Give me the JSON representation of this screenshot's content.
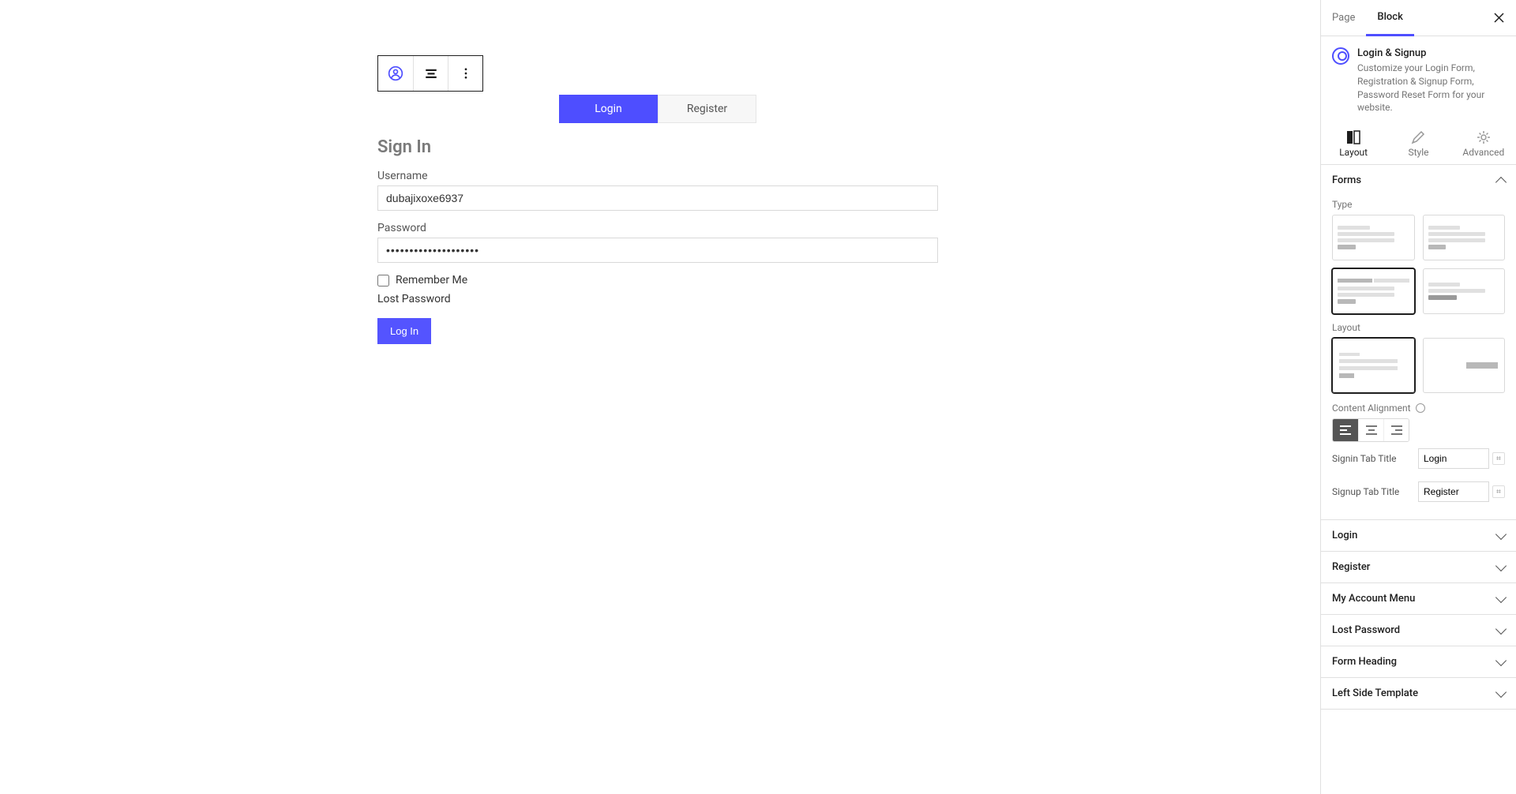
{
  "sidebar_tabs": {
    "page": "Page",
    "block": "Block"
  },
  "block_header": {
    "title": "Login & Signup",
    "desc": "Customize your Login Form, Registration & Signup Form, Password Reset Form for your website."
  },
  "subtabs": {
    "layout": "Layout",
    "style": "Style",
    "advanced": "Advanced"
  },
  "forms_panel": {
    "title": "Forms",
    "type_label": "Type",
    "layout_label": "Layout",
    "alignment_label": "Content Alignment",
    "signin_tab_label": "Signin Tab Title",
    "signin_tab_value": "Login",
    "signup_tab_label": "Signup Tab Title",
    "signup_tab_value": "Register"
  },
  "collapsed_panels": [
    "Login",
    "Register",
    "My Account Menu",
    "Lost Password",
    "Form Heading",
    "Left Side Template"
  ],
  "canvas": {
    "tabs": {
      "login": "Login",
      "register": "Register"
    },
    "title": "Sign In",
    "username_label": "Username",
    "username_value": "dubajixoxe6937",
    "password_label": "Password",
    "password_value": "••••••••••••••••••••",
    "remember_label": "Remember Me",
    "lost_label": "Lost Password",
    "submit_label": "Log In"
  }
}
